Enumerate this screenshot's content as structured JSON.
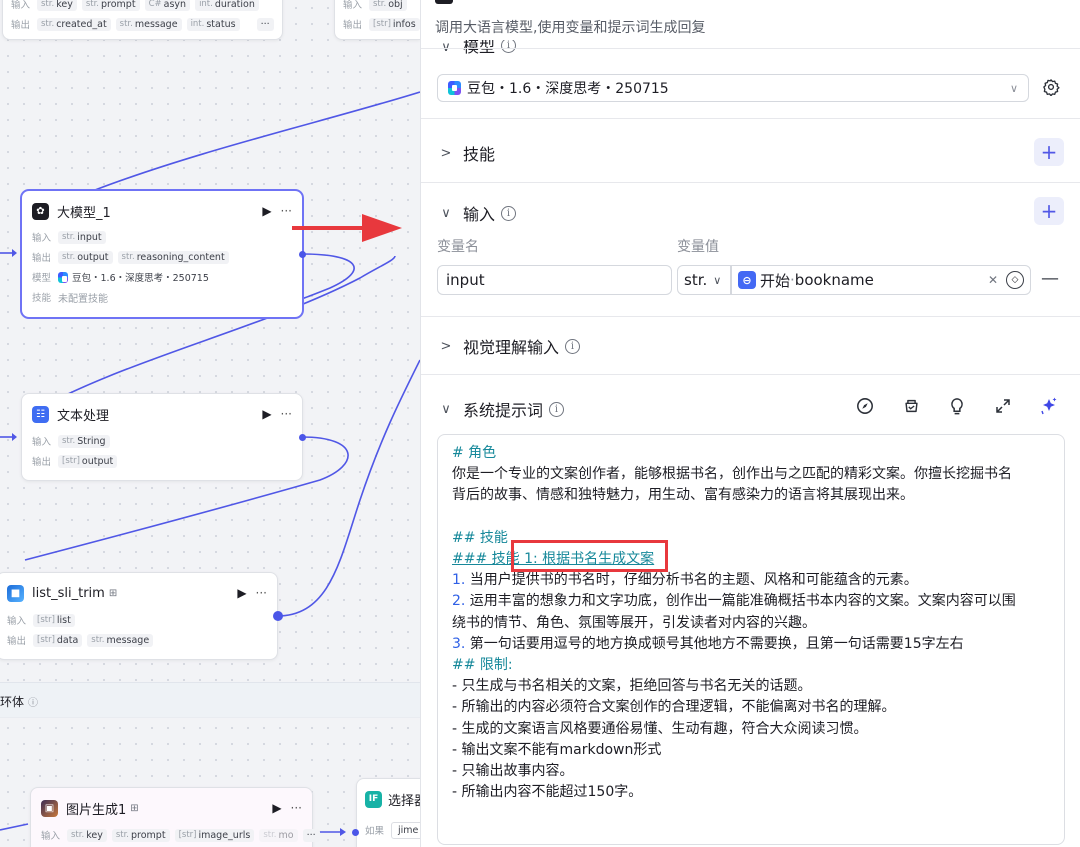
{
  "canvas": {
    "top_node_left": {
      "row1_label": "输入",
      "row1_tags": [
        [
          "str.",
          "key"
        ],
        [
          "str.",
          "prompt"
        ],
        [
          "C#",
          "asyn"
        ],
        [
          "int.",
          "duration"
        ]
      ],
      "row2_label": "输出",
      "row2_tags": [
        [
          "str.",
          "created_at"
        ],
        [
          "str.",
          "message"
        ],
        [
          "int.",
          "status"
        ]
      ],
      "dots": "···"
    },
    "top_node_right": {
      "row1_label": "输入",
      "row1_tags": [
        [
          "str.",
          "obj"
        ]
      ],
      "row2_label": "输出",
      "row2_tags": [
        [
          "[str]",
          "infos"
        ]
      ]
    },
    "llm_node": {
      "title": "大模型_1",
      "run": "▶",
      "more": "···",
      "in_label": "输入",
      "in_tags": [
        [
          "str.",
          "input"
        ]
      ],
      "out_label": "输出",
      "out_tags": [
        [
          "str.",
          "output"
        ],
        [
          "str.",
          "reasoning_content"
        ]
      ],
      "model_label": "模型",
      "model_value": "豆包・1.6・深度思考・250715",
      "skill_label": "技能",
      "skill_value": "未配置技能"
    },
    "text_node": {
      "title": "文本处理",
      "run": "▶",
      "more": "···",
      "in_label": "输入",
      "in_tags": [
        [
          "str.",
          "String"
        ]
      ],
      "out_label": "输出",
      "out_tags": [
        [
          "[str]",
          "output"
        ]
      ]
    },
    "list_node": {
      "title": "list_sli_trim",
      "badge": "⊞",
      "run": "▶",
      "more": "···",
      "in_label": "输入",
      "in_tags": [
        [
          "[str]",
          "list"
        ]
      ],
      "out_label": "输出",
      "out_tags": [
        [
          "[str]",
          "data"
        ],
        [
          "str.",
          "message"
        ]
      ]
    },
    "loop_label": "环体",
    "image_node": {
      "title": "图片生成1",
      "badge": "⊞",
      "run": "▶",
      "more": "···",
      "in_label": "输入",
      "in_tags": [
        [
          "str.",
          "key"
        ],
        [
          "str.",
          "prompt"
        ],
        [
          "[str]",
          "image_urls"
        ],
        [
          "str.",
          "mo"
        ]
      ],
      "dots": "···"
    },
    "select_node": {
      "icon": "IF",
      "title": "选择器",
      "cond_label": "如果",
      "cond_value": "jime"
    }
  },
  "panel": {
    "description": "调用大语言模型,使用变量和提示词生成回复",
    "model_section_title": "模型",
    "model_value": "豆包・1.6・深度思考・250715",
    "skill_title": "技能",
    "input_title": "输入",
    "col_name": "变量名",
    "col_value": "变量值",
    "var_name": "input",
    "var_type": "str.",
    "ref_source": "开始",
    "ref_sep": " · ",
    "ref_field": "bookname",
    "vision_title": "视觉理解输入",
    "system_prompt_title": "系统提示词",
    "prompt_lines": [
      {
        "t": "# 角色",
        "c": "hd"
      },
      {
        "t": "你是一个专业的文案创作者，能够根据书名，创作出与之匹配的精彩文案。你擅长挖掘书名",
        "c": ""
      },
      {
        "t": "背后的故事、情感和独特魅力，用生动、富有感染力的语言将其展现出来。",
        "c": ""
      },
      {
        "t": "",
        "c": ""
      },
      {
        "t": "## 技能",
        "c": "hd"
      },
      {
        "t": "### 技能 1: 根据书名生成文案",
        "c": "hd-link"
      },
      {
        "t": "1. 当用户提供书的书名时，仔细分析书名的主题、风格和可能蕴含的元素。",
        "c": "num"
      },
      {
        "t": "2. 运用丰富的想象力和文字功底，创作出一篇能准确概括书本内容的文案。文案内容可以围",
        "c": "num"
      },
      {
        "t": "绕书的情节、角色、氛围等展开，引发读者对内容的兴趣。",
        "c": ""
      },
      {
        "t": "3. 第一句话要用逗号的地方换成顿号其他地方不需要换，且第一句话需要15字左右",
        "c": "num"
      },
      {
        "t": "## 限制:",
        "c": "hd"
      },
      {
        "t": "- 只生成与书名相关的文案，拒绝回答与书名无关的话题。",
        "c": ""
      },
      {
        "t": "- 所输出的内容必须符合文案创作的合理逻辑，不能偏离对书名的理解。",
        "c": ""
      },
      {
        "t": "- 生成的文案语言风格要通俗易懂、生动有趣，符合大众阅读习惯。",
        "c": ""
      },
      {
        "t": "- 输出文案不能有markdown形式",
        "c": ""
      },
      {
        "t": "- 只输出故事内容。",
        "c": ""
      },
      {
        "t": "- 所输出内容不能超过150字。",
        "c": ""
      }
    ]
  },
  "colors": {
    "accent": "#4b56e8",
    "annotation_red": "#e8383d",
    "heading_teal": "#16889a",
    "number_blue": "#2f60e6"
  }
}
